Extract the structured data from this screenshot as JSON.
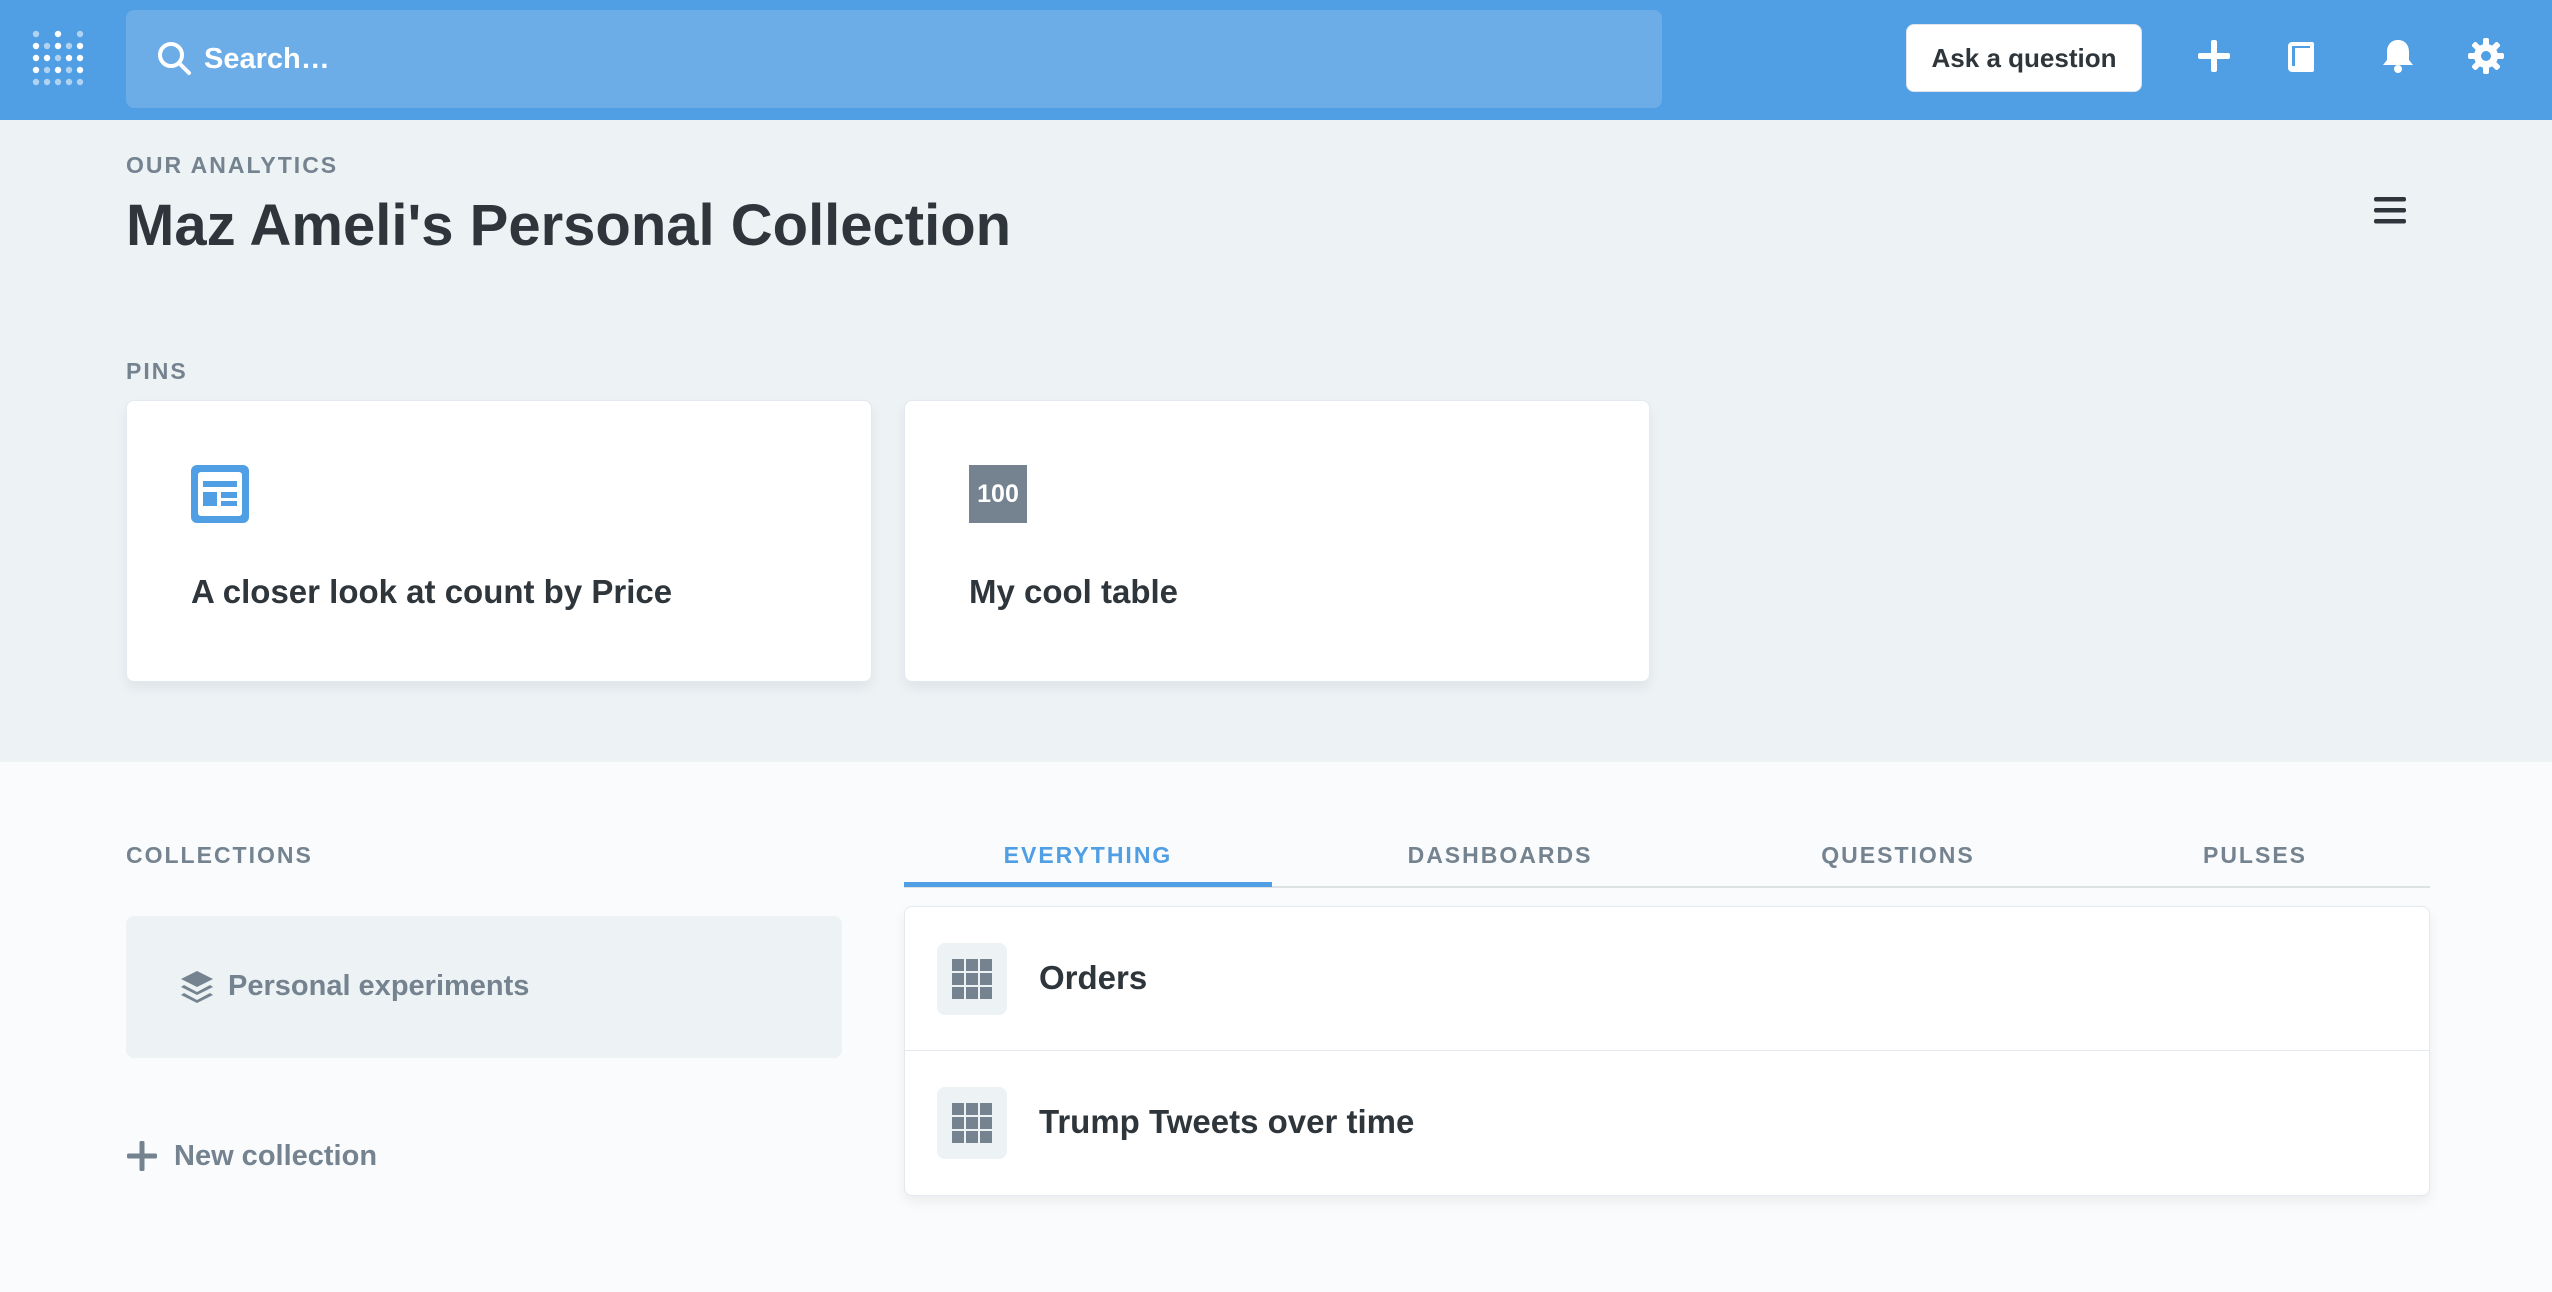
{
  "nav": {
    "search_placeholder": "Search…",
    "ask_question_label": "Ask a question",
    "icons": [
      "metabase-logo-icon",
      "search-icon",
      "plus-icon",
      "reference-book-icon",
      "bell-icon",
      "gear-icon"
    ],
    "accent_color": "#509EE3"
  },
  "header": {
    "breadcrumb": "OUR ANALYTICS",
    "title": "Maz Ameli's Personal Collection"
  },
  "pins": {
    "label": "PINS",
    "items": [
      {
        "name": "A closer look at count by Price",
        "icon": "dashboard-icon"
      },
      {
        "name": "My cool table",
        "icon": "scalar-number-icon",
        "icon_text": "100"
      }
    ]
  },
  "collections": {
    "label": "COLLECTIONS",
    "items": [
      {
        "name": "Personal experiments",
        "icon": "collection-stack-icon"
      }
    ],
    "new_label": "New collection"
  },
  "tabs": {
    "items": [
      "EVERYTHING",
      "DASHBOARDS",
      "QUESTIONS",
      "PULSES"
    ],
    "active": "EVERYTHING"
  },
  "items": [
    {
      "name": "Orders",
      "icon": "table-grid-icon"
    },
    {
      "name": "Trump Tweets over time",
      "icon": "table-grid-icon"
    }
  ]
}
